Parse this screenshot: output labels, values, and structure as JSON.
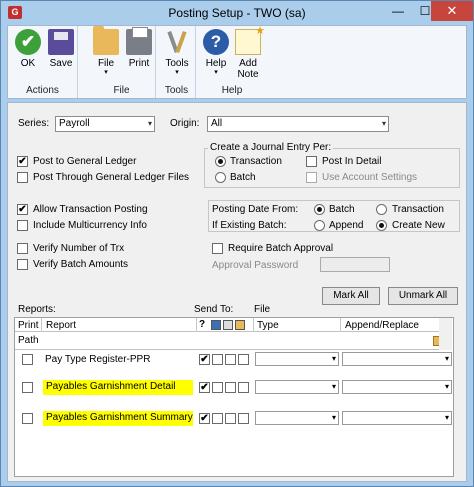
{
  "window": {
    "title": "Posting Setup  -  TWO (sa)",
    "minimize_glyph": "—",
    "maximize_glyph": "☐",
    "close_glyph": "✕",
    "app_icon_glyph": "G"
  },
  "ribbon": {
    "groups": [
      {
        "label": "Actions",
        "buttons": [
          {
            "label": "OK",
            "icon": "ok-check-icon"
          },
          {
            "label": "Save",
            "icon": "save-disk-icon"
          }
        ]
      },
      {
        "label": "File",
        "buttons": [
          {
            "label": "File",
            "icon": "folder-icon"
          },
          {
            "label": "Print",
            "icon": "printer-icon"
          }
        ]
      },
      {
        "label": "Tools",
        "buttons": [
          {
            "label": "Tools",
            "icon": "tools-icon"
          }
        ]
      },
      {
        "label": "Help",
        "buttons": [
          {
            "label": "Help",
            "icon": "help-icon"
          },
          {
            "label": "Add\nNote",
            "icon": "add-note-icon"
          }
        ]
      }
    ],
    "ok_glyph": "✔",
    "help_glyph": "?",
    "caret": "▾"
  },
  "form": {
    "series_label": "Series:",
    "series_value": "Payroll",
    "origin_label": "Origin:",
    "origin_value": "All",
    "journal_group_title": "Create a Journal Entry Per:",
    "journal_transaction": "Transaction",
    "journal_batch": "Batch",
    "post_in_detail": "Post In Detail",
    "use_account_settings": "Use Account Settings",
    "post_to_gl": "Post to General Ledger",
    "post_through_gl": "Post Through General Ledger Files",
    "allow_transaction_posting": "Allow Transaction Posting",
    "include_multicurrency": "Include Multicurrency Info",
    "posting_date_from_label": "Posting Date From:",
    "posting_date_batch": "Batch",
    "posting_date_transaction": "Transaction",
    "if_existing_batch_label": "If Existing Batch:",
    "existing_append": "Append",
    "existing_create_new": "Create New",
    "verify_number_of_trx": "Verify Number of Trx",
    "verify_batch_amounts": "Verify Batch Amounts",
    "require_batch_approval": "Require Batch Approval",
    "approval_password_label": "Approval Password",
    "checked_glyph": "✔",
    "dropdown_arrow": "▾"
  },
  "reports": {
    "reports_label": "Reports:",
    "send_to_label": "Send To:",
    "file_label": "File",
    "mark_all": "Mark All",
    "unmark_all": "Unmark All",
    "col_print": "Print",
    "col_report": "Report",
    "col_q": "?",
    "col_type": "Type",
    "col_append_replace": "Append/Replace",
    "path_label": "Path",
    "rows": [
      {
        "report": "Pay Type Register-PPR",
        "highlight": false
      },
      {
        "report": "Payables Garnishment Detail",
        "highlight": true
      },
      {
        "report": "Payables Garnishment Summary",
        "highlight": true
      }
    ]
  }
}
